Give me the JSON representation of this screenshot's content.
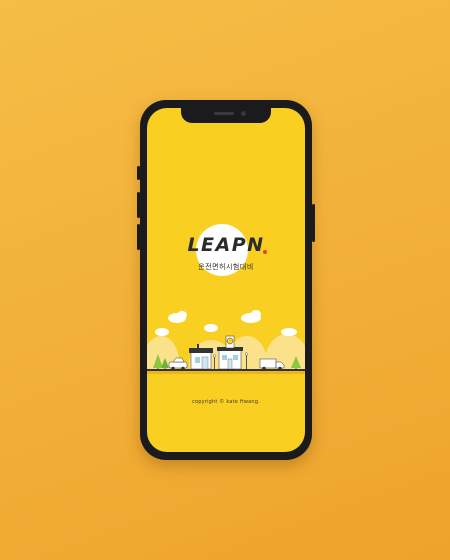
{
  "app": {
    "logo_text": "LEAPN",
    "subtitle": "운전면허시험대비",
    "copyright": "copyright © kate Hwang."
  },
  "colors": {
    "background": "#f2b23a",
    "screen": "#f9cf21",
    "phone_frame": "#1b1b1d",
    "logo_accent_dot": "#e8432e",
    "text": "#2b2b2b"
  },
  "scene": {
    "icons": [
      "cloud-icon",
      "tree-icon",
      "car-icon",
      "store-icon",
      "clock-tower-icon",
      "truck-icon",
      "road-icon"
    ]
  }
}
